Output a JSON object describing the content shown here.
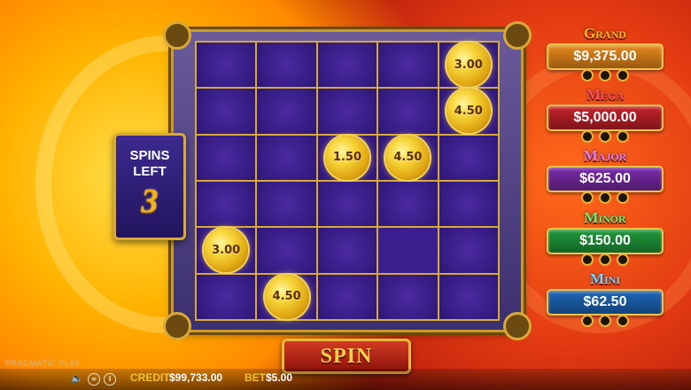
{
  "spins_left": {
    "label_line1": "SPINS",
    "label_line2": "LEFT",
    "value": "3"
  },
  "grid": {
    "rows": 6,
    "cols": 5,
    "cells": [
      [
        "",
        "",
        "",
        "",
        "3.00"
      ],
      [
        "",
        "",
        "",
        "",
        "4.50"
      ],
      [
        "",
        "",
        "1.50",
        "4.50",
        ""
      ],
      [
        "",
        "",
        "",
        "",
        ""
      ],
      [
        "3.00",
        "",
        "",
        "empty",
        ""
      ],
      [
        "",
        "4.50",
        "",
        "",
        ""
      ]
    ]
  },
  "jackpots": [
    {
      "name": "Grand",
      "value": "$9,375.00",
      "color": "#e8891a",
      "name_color": "#f7b52a"
    },
    {
      "name": "Mega",
      "value": "$5,000.00",
      "color": "#c4202a",
      "name_color": "#ff5060"
    },
    {
      "name": "Major",
      "value": "$625.00",
      "color": "#7a2aa8",
      "name_color": "#e27af5"
    },
    {
      "name": "Minor",
      "value": "$150.00",
      "color": "#1f9a3a",
      "name_color": "#5ef07a"
    },
    {
      "name": "Mini",
      "value": "$62.50",
      "color": "#1e66b8",
      "name_color": "#7fd0ff"
    }
  ],
  "spin_button": {
    "label": "SPIN"
  },
  "bottom_bar": {
    "brand": "PRAGMATIC PLAY",
    "credit_label": "CREDIT",
    "credit_value": "$99,733.00",
    "bet_label": "BET",
    "bet_value": "$5.00",
    "icons": [
      "speaker-icon",
      "menu-icon",
      "info-icon"
    ]
  }
}
